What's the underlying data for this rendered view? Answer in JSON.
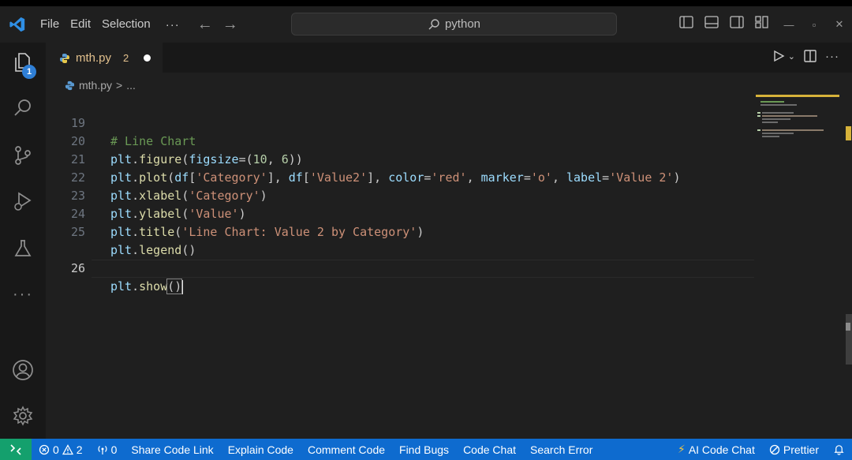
{
  "titlebar": {
    "menu": [
      "File",
      "Edit",
      "Selection"
    ],
    "more": "···",
    "search_text": "python"
  },
  "activity": {
    "explorer_badge": "1"
  },
  "tab": {
    "name": "mth.py",
    "problems": "2"
  },
  "breadcrumb": {
    "file": "mth.py",
    "sep": ">",
    "rest": "..."
  },
  "code": {
    "lines": [
      {
        "n": "19",
        "t": "# Line Chart"
      },
      {
        "n": "20",
        "t": "plt.figure(figsize=(10, 6))"
      },
      {
        "n": "21",
        "t": "plt.plot(df['Category'], df['Value2'], color='red', marker='o', label='Value 2')"
      },
      {
        "n": "22",
        "t": "plt.xlabel('Category')"
      },
      {
        "n": "23",
        "t": "plt.ylabel('Value')"
      },
      {
        "n": "24",
        "t": "plt.title('Line Chart: Value 2 by Category')"
      },
      {
        "n": "25",
        "t": "plt.legend()"
      },
      {
        "n": "26",
        "t": "plt.show()"
      }
    ]
  },
  "statusbar": {
    "errors": "0",
    "warnings": "2",
    "ports": "0",
    "items": [
      "Share Code Link",
      "Explain Code",
      "Comment Code",
      "Find Bugs",
      "Code Chat",
      "Search Error"
    ],
    "ai_chat": "AI Code Chat",
    "prettier": "Prettier",
    "remote_color": "#14a06d",
    "bar_color": "#0e6bcf"
  }
}
